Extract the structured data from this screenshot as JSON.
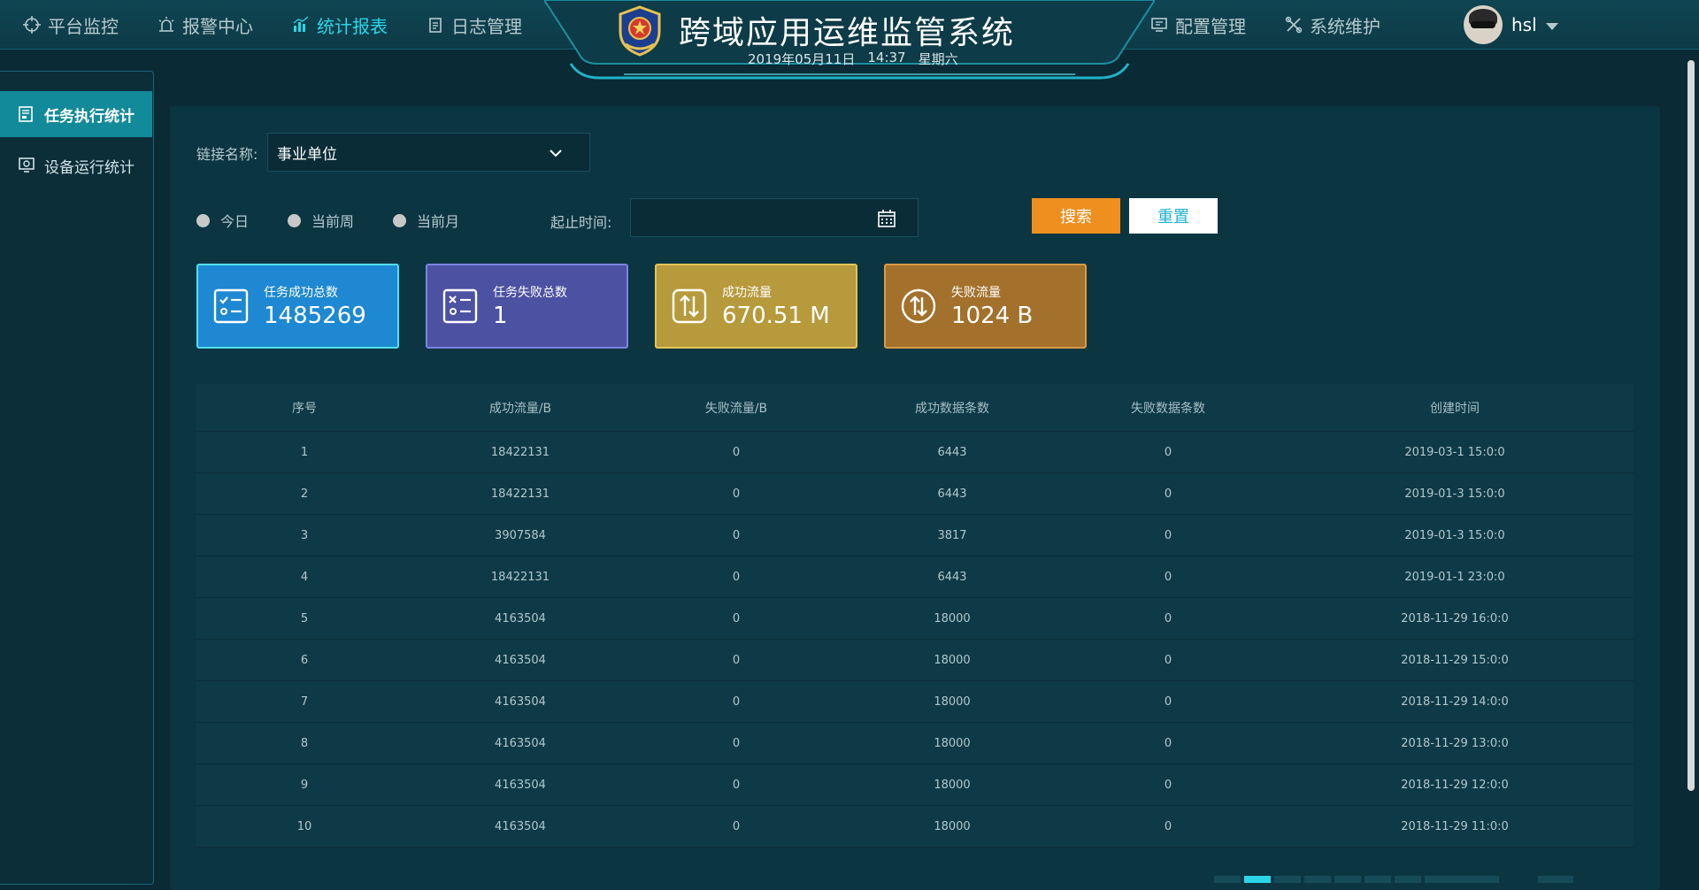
{
  "nav": {
    "left": [
      {
        "label": "平台监控",
        "icon": "crosshair-icon"
      },
      {
        "label": "报警中心",
        "icon": "alarm-light-icon"
      },
      {
        "label": "统计报表",
        "icon": "bar-chart-icon",
        "active": true
      },
      {
        "label": "日志管理",
        "icon": "clipboard-icon"
      }
    ],
    "right": [
      {
        "label": "配置管理",
        "icon": "monitor-icon"
      },
      {
        "label": "系统维护",
        "icon": "tools-icon"
      }
    ]
  },
  "header": {
    "title": "跨域应用运维监管系统",
    "date": "2019年05月11日",
    "time": "14:37",
    "weekday": "星期六"
  },
  "user": {
    "name": "hsl"
  },
  "sidebar": {
    "items": [
      {
        "label": "任务执行统计",
        "icon": "report-icon",
        "active": true
      },
      {
        "label": "设备运行统计",
        "icon": "device-monitor-icon"
      }
    ]
  },
  "filters": {
    "link_label": "链接名称:",
    "link_value": "事业单位",
    "radios": [
      "今日",
      "当前周",
      "当前月"
    ],
    "range_label": "起止时间:",
    "range_value": "",
    "search_label": "搜索",
    "reset_label": "重置"
  },
  "cards": [
    {
      "title": "任务成功总数",
      "value": "1485269",
      "icon": "checklist-icon"
    },
    {
      "title": "任务失败总数",
      "value": "1",
      "icon": "fail-list-icon"
    },
    {
      "title": "成功流量",
      "value": "670.51 M",
      "icon": "transfer-icon"
    },
    {
      "title": "失败流量",
      "value": "1024 B",
      "icon": "transfer-circle-icon"
    }
  ],
  "table": {
    "headers": [
      "序号",
      "成功流量/B",
      "失败流量/B",
      "成功数据条数",
      "失败数据条数",
      "创建时间"
    ],
    "rows": [
      [
        "1",
        "18422131",
        "0",
        "6443",
        "0",
        "2019-03-1 15:0:0"
      ],
      [
        "2",
        "18422131",
        "0",
        "6443",
        "0",
        "2019-01-3 15:0:0"
      ],
      [
        "3",
        "3907584",
        "0",
        "3817",
        "0",
        "2019-01-3 15:0:0"
      ],
      [
        "4",
        "18422131",
        "0",
        "6443",
        "0",
        "2019-01-1 23:0:0"
      ],
      [
        "5",
        "4163504",
        "0",
        "18000",
        "0",
        "2018-11-29 16:0:0"
      ],
      [
        "6",
        "4163504",
        "0",
        "18000",
        "0",
        "2018-11-29 15:0:0"
      ],
      [
        "7",
        "4163504",
        "0",
        "18000",
        "0",
        "2018-11-29 14:0:0"
      ],
      [
        "8",
        "4163504",
        "0",
        "18000",
        "0",
        "2018-11-29 13:0:0"
      ],
      [
        "9",
        "4163504",
        "0",
        "18000",
        "0",
        "2018-11-29 12:0:0"
      ],
      [
        "10",
        "4163504",
        "0",
        "18000",
        "0",
        "2018-11-29 11:0:0"
      ]
    ]
  },
  "colors": {
    "accent": "#2bd5e8",
    "search_button": "#ef8f1f",
    "card_success": "#1e88d2",
    "card_fail": "#4c51a2",
    "card_flow_ok": "#b79a3b",
    "card_flow_fail": "#a3712c"
  }
}
